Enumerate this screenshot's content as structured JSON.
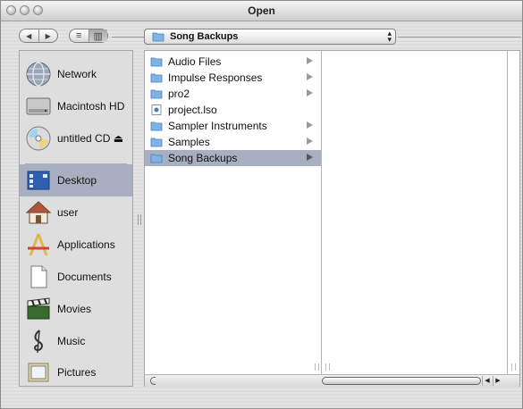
{
  "window": {
    "title": "Open"
  },
  "toolbar": {
    "nav_back": "◀",
    "nav_forward": "▶",
    "view_list": "≡",
    "view_columns": "▥",
    "location": "Song Backups"
  },
  "sidebar": {
    "devices": [
      {
        "label": "Network",
        "icon": "network-icon"
      },
      {
        "label": "Macintosh HD",
        "icon": "hard-disk-icon"
      },
      {
        "label": "untitled CD ⏏",
        "icon": "cd-icon"
      }
    ],
    "places": [
      {
        "label": "Desktop",
        "icon": "desktop-icon",
        "selected": true
      },
      {
        "label": "user",
        "icon": "home-icon"
      },
      {
        "label": "Applications",
        "icon": "applications-icon"
      },
      {
        "label": "Documents",
        "icon": "documents-icon"
      },
      {
        "label": "Movies",
        "icon": "movies-icon"
      },
      {
        "label": "Music",
        "icon": "music-icon"
      },
      {
        "label": "Pictures",
        "icon": "pictures-icon"
      }
    ]
  },
  "browser": {
    "column1": [
      {
        "name": "Audio Files",
        "type": "folder",
        "has_children": true
      },
      {
        "name": "Impulse Responses",
        "type": "folder",
        "has_children": true
      },
      {
        "name": "pro2",
        "type": "folder",
        "has_children": true
      },
      {
        "name": "project.lso",
        "type": "file",
        "has_children": false
      },
      {
        "name": "Sampler Instruments",
        "type": "folder",
        "has_children": true
      },
      {
        "name": "Samples",
        "type": "folder",
        "has_children": true
      },
      {
        "name": "Song Backups",
        "type": "folder",
        "has_children": true,
        "selected": true
      }
    ]
  },
  "colors": {
    "selection": "#a8afc0",
    "folder": "#7fb3e8"
  }
}
